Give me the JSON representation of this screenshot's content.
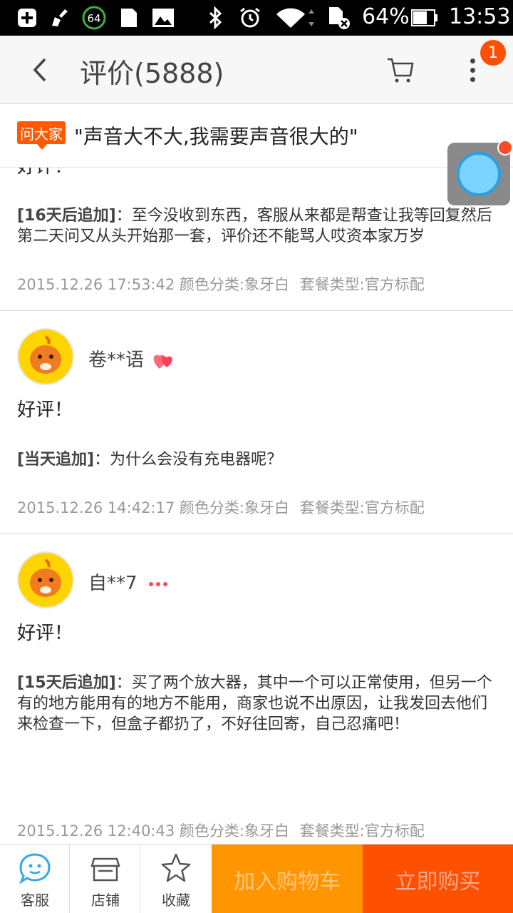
{
  "status_bar": {
    "battery_icon_value": "64",
    "battery_percent": "64%",
    "time": "13:53",
    "icons": [
      "plus-box-icon",
      "broom-icon",
      "circle-64-icon",
      "sd-card-icon",
      "image-icon",
      "bluetooth-icon",
      "alarm-icon",
      "wifi-icon",
      "sim-off-icon",
      "battery-icon"
    ]
  },
  "header": {
    "title": "评价(5888)",
    "cart_icon": "cart-icon",
    "more_icon": "more-vertical-icon",
    "badge_count": "1"
  },
  "ask": {
    "tag": "问大家",
    "question": "\"声音大不大,我需要声音很大的\""
  },
  "reviews": [
    {
      "partial_top_text": "好评！",
      "append_tag": "[16天后追加]",
      "append_text": "：至今没收到东西，客服从来都是帮查让我等回复然后第二天问又从头开始那一套，评价还不能骂人哎资本家万岁",
      "date": "2015.12.26 17:53:42",
      "color": "颜色分类:象牙白",
      "package": "套餐类型:官方标配"
    },
    {
      "user": "卷**语",
      "level_icon": "heart-level-icon",
      "content": "好评！",
      "append_tag": "[当天追加]",
      "append_text": "：为什么会没有充电器呢？",
      "date": "2015.12.26 14:42:17",
      "color": "颜色分类:象牙白",
      "package": "套餐类型:官方标配"
    },
    {
      "user": "自**7",
      "level_icon": "small-hearts-level-icon",
      "content": "好评！",
      "append_tag": "[15天后追加]",
      "append_text": "：买了两个放大器，其中一个可以正常使用，但另一个有的地方能用有的地方不能用，商家也说不出原因，让我发回去他们来检查一下，但盒子都扔了，不好往回寄，自己忍痛吧！",
      "date": "2015.12.26 12:40:43",
      "color": "颜色分类:象牙白",
      "package": "套餐类型:官方标配"
    }
  ],
  "bottom_bar": {
    "service": "客服",
    "shop": "店铺",
    "favorite": "收藏",
    "add_to_cart": "加入购物车",
    "buy_now": "立即购买"
  },
  "colors": {
    "accent_orange": "#ff9500",
    "accent_red_orange": "#ff5000",
    "tag_orange": "#ff5a00",
    "service_blue": "#33a8e8"
  }
}
